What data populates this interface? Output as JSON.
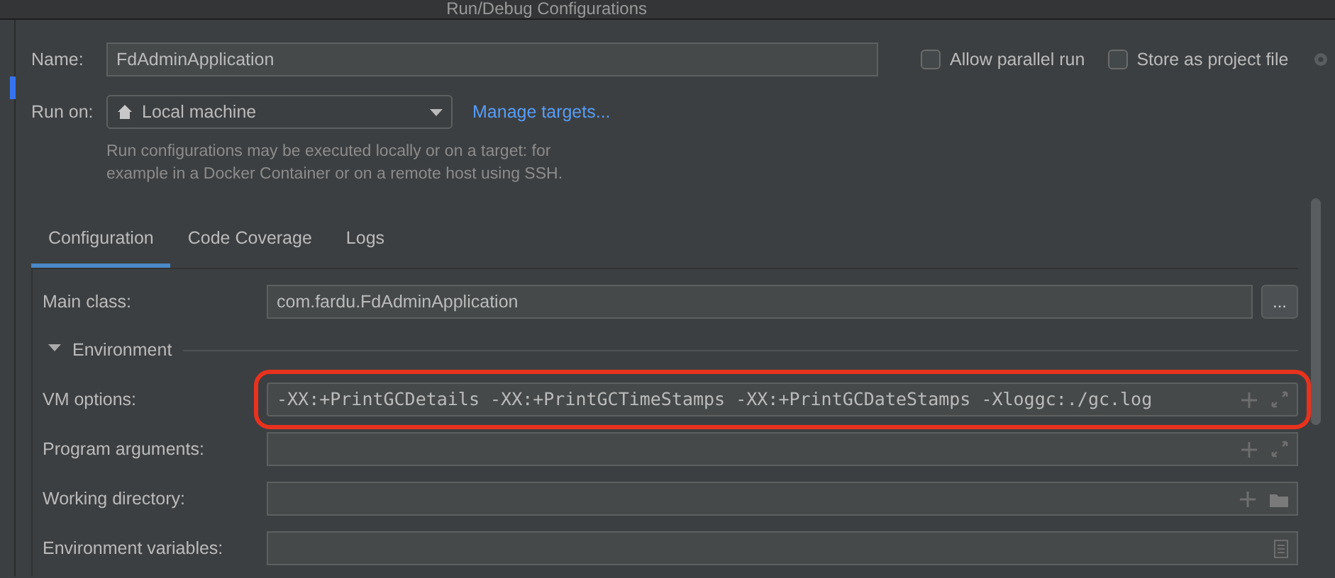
{
  "window": {
    "title": "Run/Debug Configurations"
  },
  "name": {
    "label": "Name:",
    "value": "FdAdminApplication"
  },
  "options": [
    {
      "label": "Allow parallel run",
      "checked": false
    },
    {
      "label": "Store as project file",
      "checked": false
    }
  ],
  "run_on": {
    "label": "Run on:",
    "value": "Local machine",
    "link": "Manage targets..."
  },
  "hint": "Run configurations may be executed locally or on a target: for example in a Docker Container or on a remote host using SSH.",
  "tabs": [
    {
      "label": "Configuration",
      "selected": true
    },
    {
      "label": "Code Coverage",
      "selected": false
    },
    {
      "label": "Logs",
      "selected": false
    }
  ],
  "main_class": {
    "label": "Main class:",
    "value": "com.fardu.FdAdminApplication",
    "button": "..."
  },
  "section": {
    "label": "Environment",
    "expanded": true
  },
  "fields": [
    {
      "label": "VM options:",
      "value": "-XX:+PrintGCDetails -XX:+PrintGCTimeStamps -XX:+PrintGCDateStamps -Xloggc:./gc.log",
      "kind": "expand",
      "highlighted": true
    },
    {
      "label": "Program arguments:",
      "kind": "expand",
      "highlighted": false
    },
    {
      "label": "Working directory:",
      "kind": "folder",
      "highlighted": false
    },
    {
      "label": "Environment variables:",
      "kind": "document",
      "highlighted": false
    }
  ]
}
